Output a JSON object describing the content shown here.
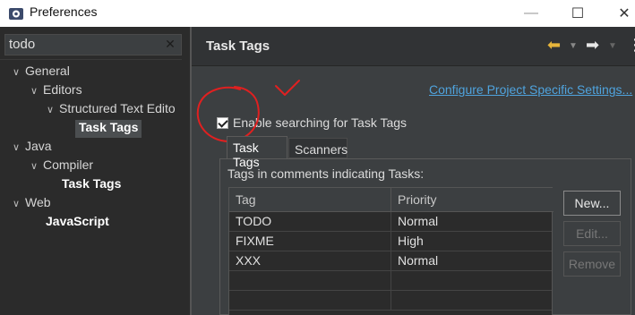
{
  "window": {
    "title": "Preferences",
    "controls": [
      "minimize",
      "maximize",
      "close"
    ]
  },
  "filter": {
    "value": "todo",
    "clear_icon": "clear-icon"
  },
  "tree": [
    {
      "label": "General",
      "level": 0,
      "expanded": true
    },
    {
      "label": "Editors",
      "level": 1,
      "expanded": true
    },
    {
      "label": "Structured Text Edito",
      "level": 2,
      "expanded": true
    },
    {
      "label": "Task Tags",
      "level": 3,
      "selected": true
    },
    {
      "label": "Java",
      "level": 0,
      "expanded": true
    },
    {
      "label": "Compiler",
      "level": 1,
      "expanded": true
    },
    {
      "label": "Task Tags",
      "level": 2
    },
    {
      "label": "Web",
      "level": 0,
      "expanded": true
    },
    {
      "label": "JavaScript",
      "level": 1
    }
  ],
  "page": {
    "title": "Task Tags",
    "config_link": "Configure Project Specific Settings...",
    "enable_label": "Enable searching for Task Tags",
    "enable_checked": true
  },
  "tabs": [
    "Task Tags",
    "Scanners"
  ],
  "table": {
    "caption": "Tags in comments indicating Tasks:",
    "columns": [
      "Tag",
      "Priority"
    ],
    "rows": [
      {
        "tag": "TODO",
        "priority": "Normal"
      },
      {
        "tag": "FIXME",
        "priority": "High"
      },
      {
        "tag": "XXX",
        "priority": "Normal"
      },
      {
        "tag": "",
        "priority": ""
      },
      {
        "tag": "",
        "priority": ""
      }
    ]
  },
  "buttons": {
    "new": "New...",
    "edit": "Edit...",
    "remove": "Remove"
  },
  "colors": {
    "link": "#4fa3dd",
    "annotation": "#e02020",
    "back_arrow": "#e7b53b"
  }
}
